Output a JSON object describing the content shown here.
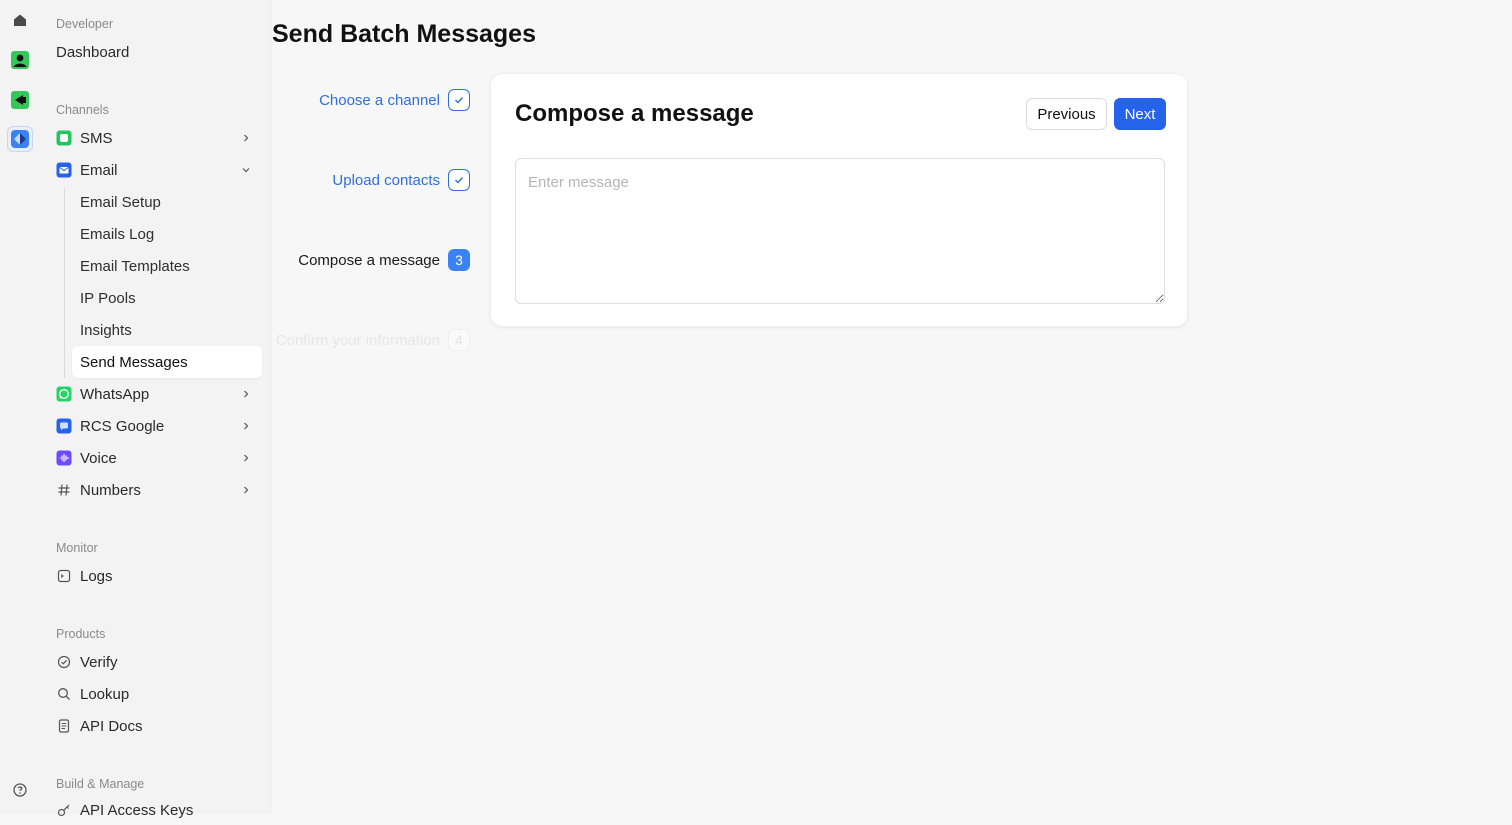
{
  "sidebar": {
    "developer": {
      "section": "Developer",
      "dashboard": "Dashboard"
    },
    "channels": {
      "section": "Channels",
      "sms": "SMS",
      "email": "Email",
      "email_items": [
        "Email Setup",
        "Emails Log",
        "Email Templates",
        "IP Pools",
        "Insights",
        "Send Messages"
      ],
      "whatsapp": "WhatsApp",
      "rcs_google": "RCS Google",
      "voice": "Voice",
      "numbers": "Numbers"
    },
    "monitor": {
      "section": "Monitor",
      "logs": "Logs"
    },
    "products": {
      "section": "Products",
      "verify": "Verify",
      "lookup": "Lookup",
      "api_docs": "API Docs"
    },
    "build": {
      "section": "Build & Manage",
      "api_keys": "API Access Keys"
    }
  },
  "page": {
    "title": "Send Batch Messages"
  },
  "steps": [
    {
      "label": "Choose a channel",
      "state": "done"
    },
    {
      "label": "Upload contacts",
      "state": "done"
    },
    {
      "label": "Compose a message",
      "state": "current",
      "number": "3"
    },
    {
      "label": "Confirm your information",
      "state": "upcoming",
      "number": "4"
    }
  ],
  "compose": {
    "title": "Compose a message",
    "previous": "Previous",
    "next": "Next",
    "placeholder": "Enter message",
    "value": ""
  },
  "colors": {
    "accent": "#2563eb",
    "step_current": "#3b82f6",
    "sms": "#22c55e",
    "email": "#2563eb",
    "whatsapp": "#25d366",
    "voice": "#6d4aff"
  },
  "icons": {
    "rail": [
      "home-icon",
      "user-app-icon",
      "video-app-icon",
      "developer-app-icon",
      "help-icon"
    ],
    "sidebar": [
      "sms-icon",
      "email-icon",
      "whatsapp-icon",
      "rcs-icon",
      "voice-icon",
      "hash-icon",
      "logs-icon",
      "verify-icon",
      "search-icon",
      "document-icon",
      "key-icon"
    ]
  }
}
